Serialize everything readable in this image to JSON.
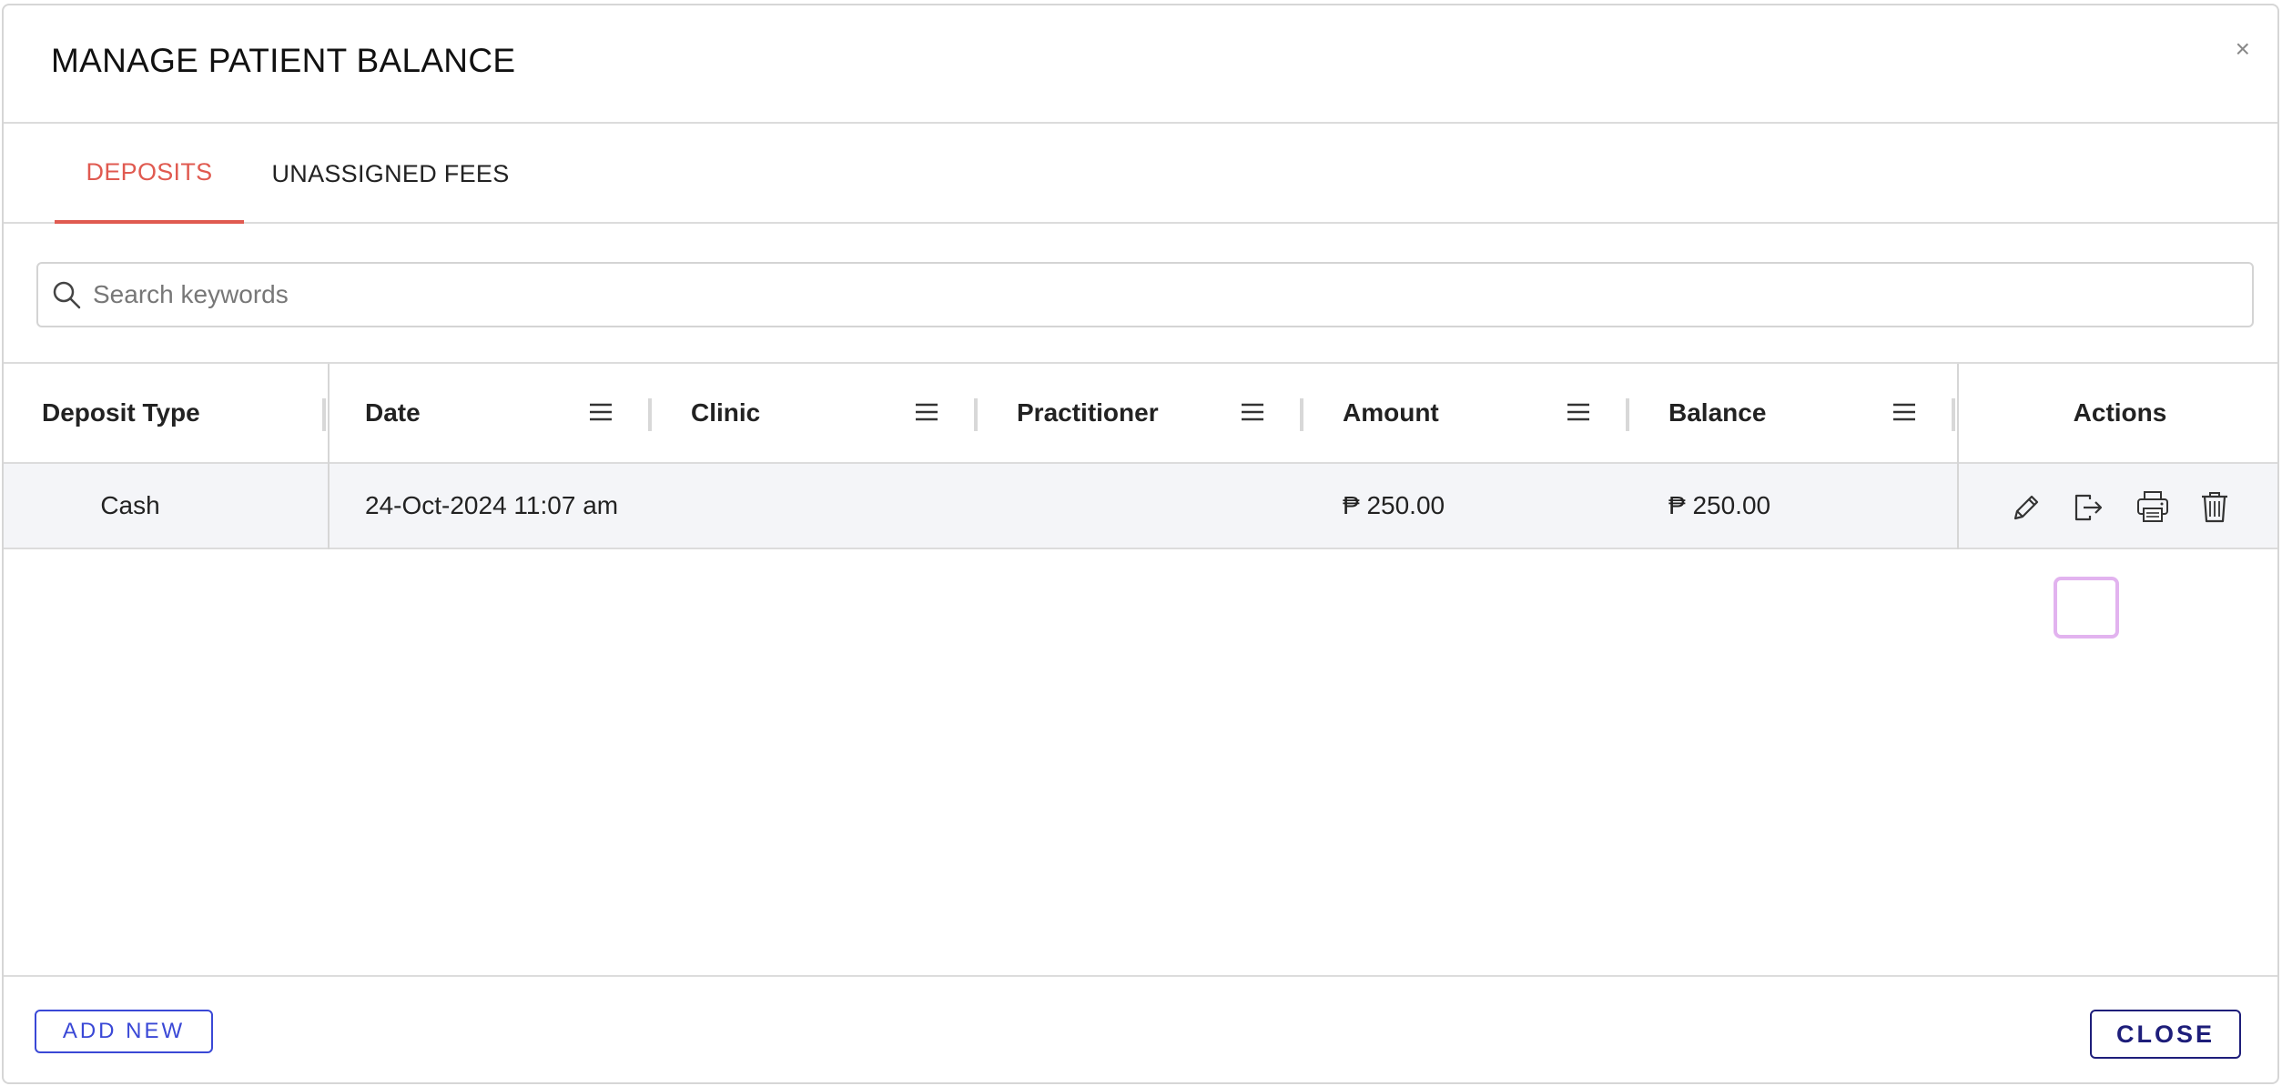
{
  "modal": {
    "title": "MANAGE PATIENT BALANCE",
    "close_symbol": "×"
  },
  "tabs": [
    {
      "label": "DEPOSITS",
      "active": true
    },
    {
      "label": "UNASSIGNED FEES",
      "active": false
    }
  ],
  "search": {
    "placeholder": "Search keywords",
    "value": "",
    "icon": "search-icon"
  },
  "table": {
    "headers": [
      "Deposit Type",
      "Date",
      "Clinic",
      "Practitioner",
      "Amount",
      "Balance",
      "Actions"
    ],
    "rows": [
      {
        "deposit_type": "Cash",
        "date": "24-Oct-2024 11:07 am",
        "clinic": "",
        "practitioner": "",
        "amount": "₱ 250.00",
        "balance": "₱ 250.00"
      }
    ],
    "actions": [
      "pencil-icon",
      "apply-deposit-icon",
      "printer-icon",
      "trash-icon"
    ]
  },
  "footer": {
    "add_new_label": "ADD NEW",
    "close_label": "CLOSE"
  },
  "colors": {
    "active_tab": "#e05a50",
    "add_button": "#3a48d6",
    "close_button": "#1e1e7a",
    "row_background": "#f4f5f8",
    "action_highlight": "#e2b3ef"
  }
}
